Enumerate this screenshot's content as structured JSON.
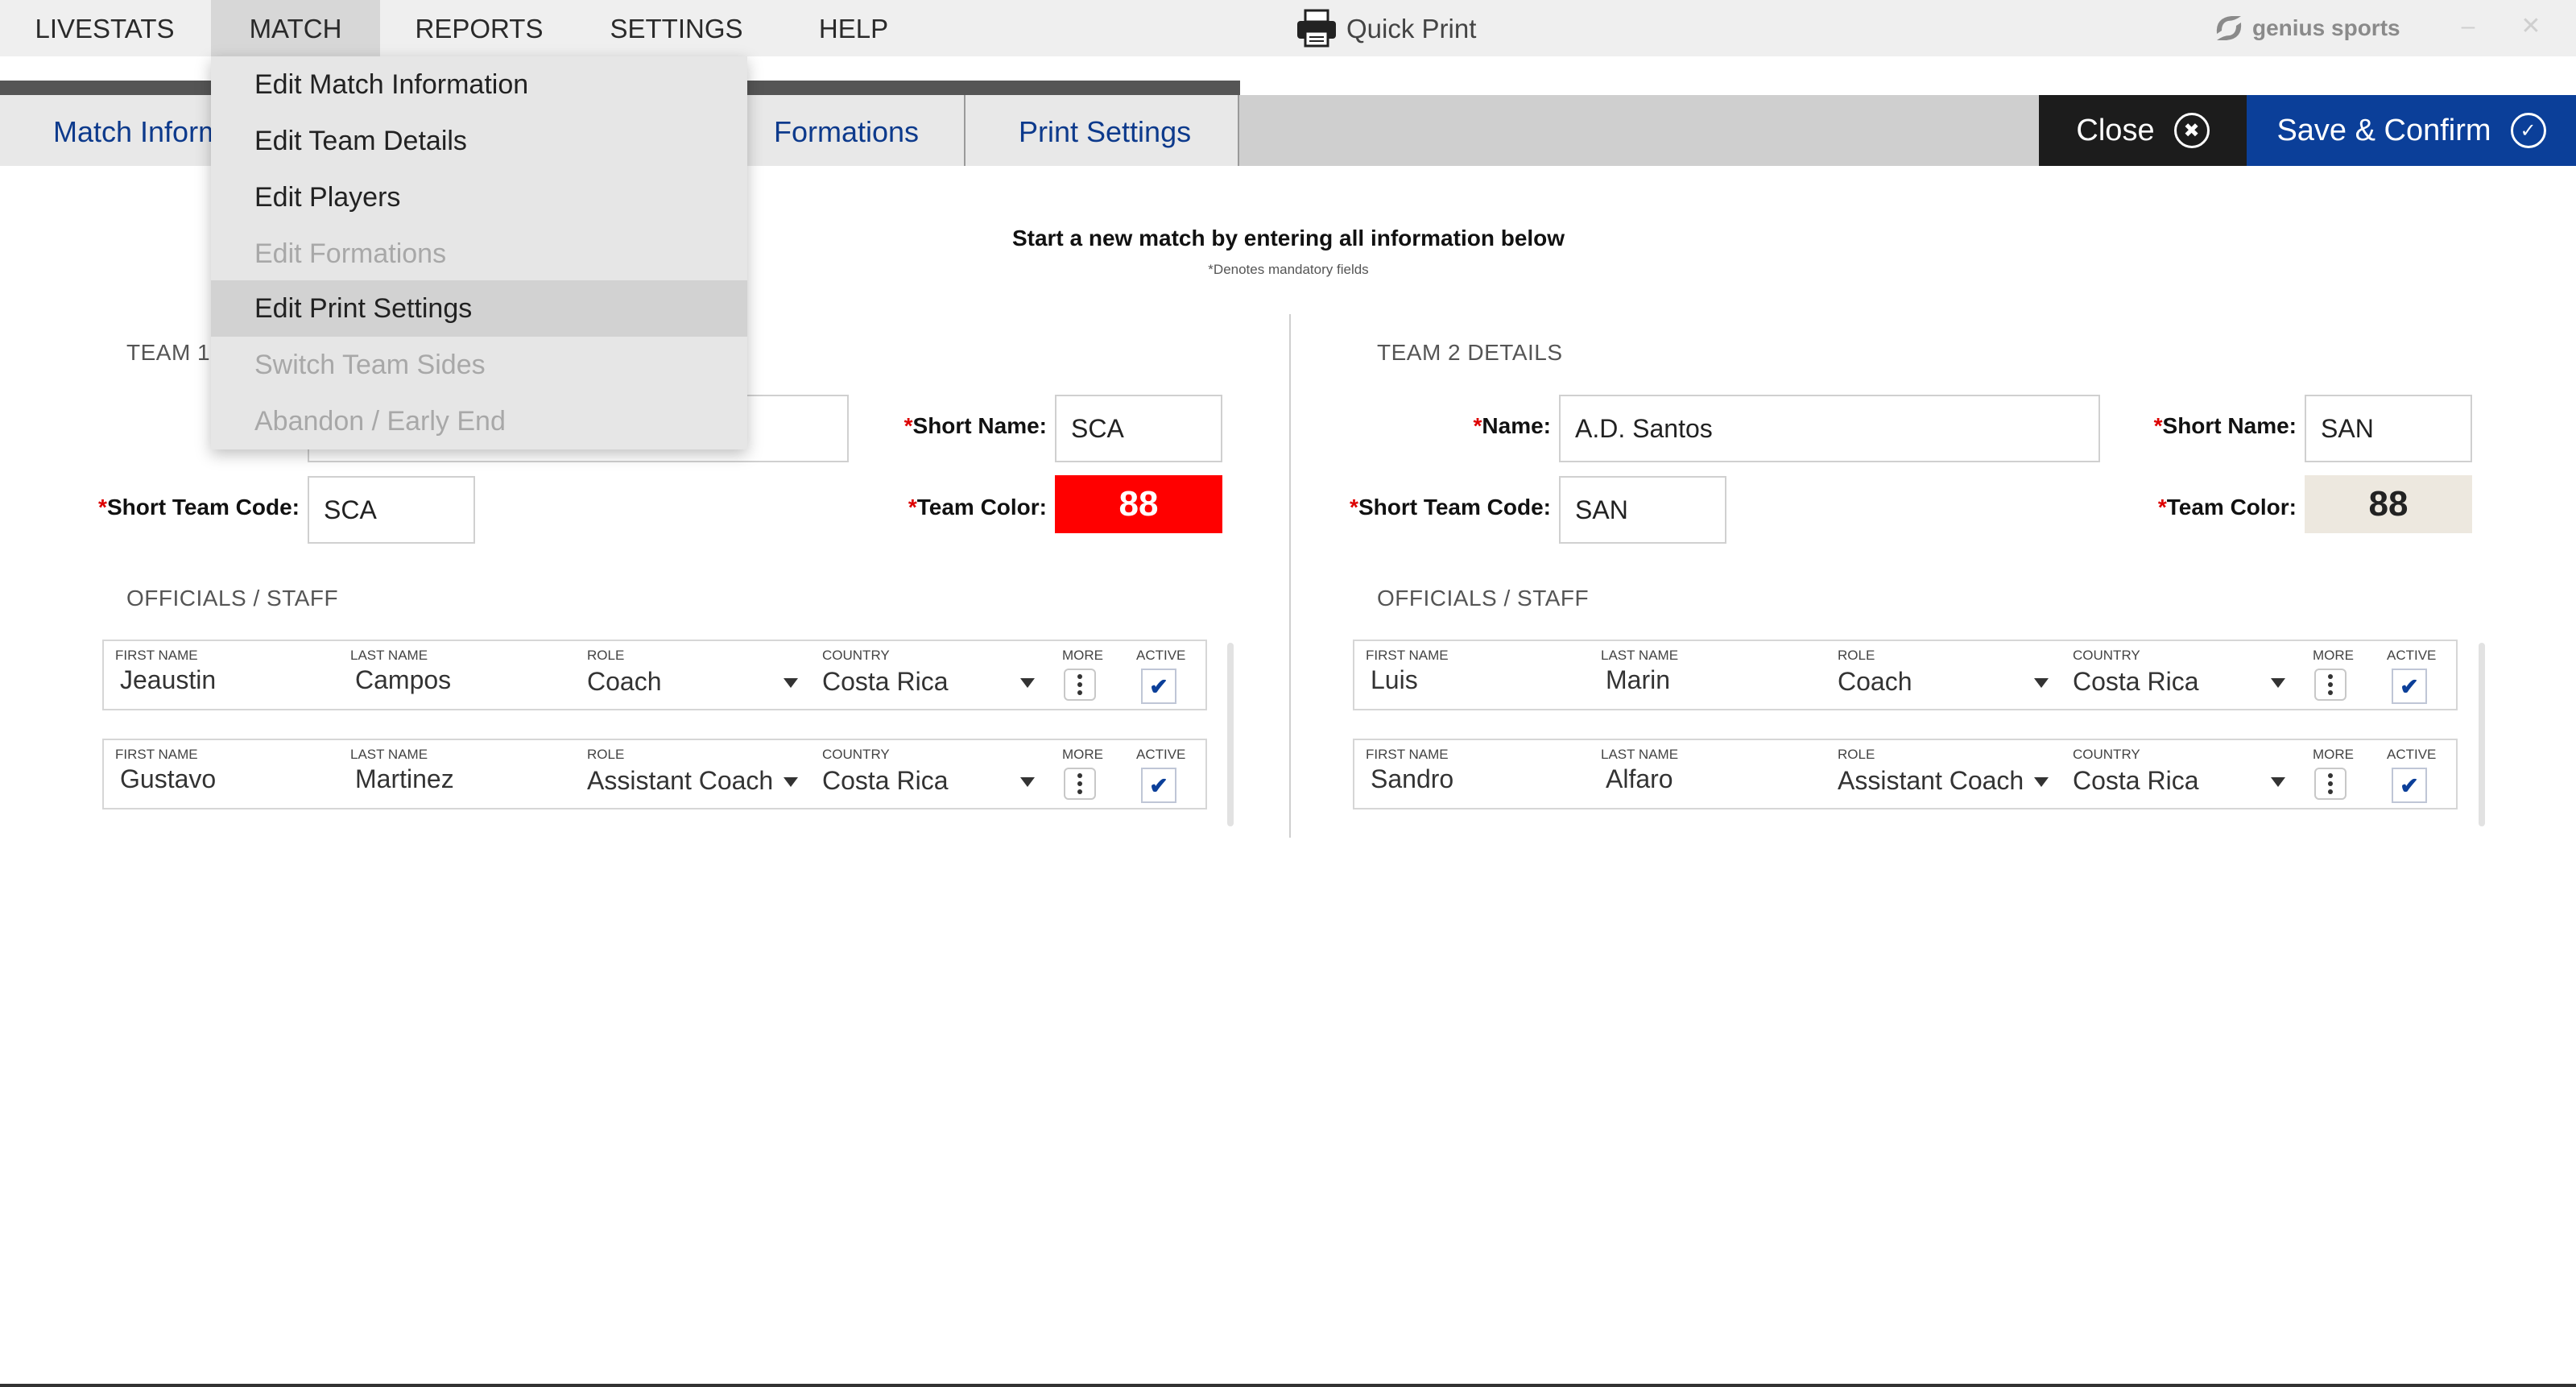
{
  "menubar": {
    "items": [
      {
        "label": "LIVESTATS"
      },
      {
        "label": "MATCH"
      },
      {
        "label": "REPORTS"
      },
      {
        "label": "SETTINGS"
      },
      {
        "label": "HELP"
      }
    ],
    "quick_print": "Quick Print",
    "brand": "genius sports",
    "minimize": "–",
    "close": "✕"
  },
  "dropdown": {
    "items": [
      {
        "label": "Edit Match Information",
        "state": "enabled"
      },
      {
        "label": "Edit Team Details",
        "state": "enabled"
      },
      {
        "label": "Edit Players",
        "state": "enabled"
      },
      {
        "label": "Edit Formations",
        "state": "disabled"
      },
      {
        "label": "Edit Print Settings",
        "state": "highlighted"
      },
      {
        "label": "Switch Team Sides",
        "state": "disabled"
      },
      {
        "label": "Abandon / Early End",
        "state": "disabled"
      }
    ]
  },
  "tabs": [
    {
      "label": "Match Information"
    },
    {
      "label": "Formations"
    },
    {
      "label": "Print Settings"
    }
  ],
  "actions": {
    "close_label": "Close",
    "save_label": "Save & Confirm"
  },
  "intro": {
    "title": "Start a new match by entering all information below",
    "subtitle": "*Denotes mandatory fields"
  },
  "labels": {
    "name": "Name:",
    "short_name": "Short Name:",
    "short_team_code": "Short Team Code:",
    "team_color": "Team Color:",
    "required": "*",
    "officials": "OFFICIALS / STAFF",
    "first_name": "FIRST NAME",
    "last_name": "LAST NAME",
    "role": "ROLE",
    "country": "COUNTRY",
    "more": "MORE",
    "active": "ACTIVE"
  },
  "team1": {
    "heading": "TEAM 1 DETAILS",
    "name": "",
    "short_name": "SCA",
    "short_team_code": "SCA",
    "team_color_number": "88",
    "team_color_bg": "#ff0000",
    "team_color_fg": "#ffffff",
    "staff": [
      {
        "first": "Jeaustin",
        "last": "Campos",
        "role": "Coach",
        "country": "Costa Rica",
        "active": true
      },
      {
        "first": "Gustavo",
        "last": "Martinez",
        "role": "Assistant Coach",
        "country": "Costa Rica",
        "active": true
      }
    ]
  },
  "team2": {
    "heading": "TEAM 2 DETAILS",
    "name": "A.D. Santos",
    "short_name": "SAN",
    "short_team_code": "SAN",
    "team_color_number": "88",
    "team_color_bg": "#ede8df",
    "team_color_fg": "#222222",
    "staff": [
      {
        "first": "Luis",
        "last": "Marin",
        "role": "Coach",
        "country": "Costa Rica",
        "active": true
      },
      {
        "first": "Sandro",
        "last": "Alfaro",
        "role": "Assistant Coach",
        "country": "Costa Rica",
        "active": true
      }
    ]
  },
  "colors": {
    "accent": "#0b3f99",
    "required": "#dd0000"
  }
}
